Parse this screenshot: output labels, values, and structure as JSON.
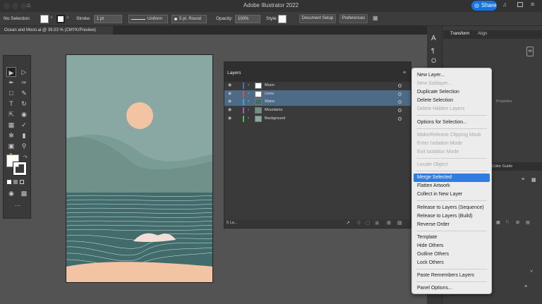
{
  "window": {
    "title": "Adobe Illustrator 2022",
    "share_label": "Share"
  },
  "controlbar": {
    "selection": "No Selection",
    "stroke_label": "Stroke:",
    "stroke_value": "1 pt",
    "uniform": "Uniform",
    "brush": "5 pt. Round",
    "opacity_label": "Opacity:",
    "opacity_value": "100%",
    "style_label": "Style:",
    "document_setup": "Document Setup",
    "preferences": "Preferences"
  },
  "document": {
    "tab": "Ocean and Moon.ai @ 39.53 % (CMYK/Preview)"
  },
  "layers_panel": {
    "title": "Layers",
    "status": "5 La...",
    "layers": [
      {
        "name": "Moon",
        "color": "#4f6bd1",
        "selected": false
      },
      {
        "name": "Lines",
        "color": "#d94f4f",
        "selected": true
      },
      {
        "name": "Water",
        "color": "#3ca3d9",
        "selected": true
      },
      {
        "name": "Mountains",
        "color": "#b04fd1",
        "selected": false
      },
      {
        "name": "Background",
        "color": "#3cc64f",
        "selected": false
      }
    ]
  },
  "right_panel": {
    "tab1": "Transform",
    "tab2": "Align",
    "properties_fragment": "Properties",
    "color_guide_fragment": "Color Guide"
  },
  "context_menu": {
    "items": [
      {
        "label": "New Layer...",
        "state": "enabled"
      },
      {
        "label": "New Sublayer...",
        "state": "disabled"
      },
      {
        "label": "Duplicate Selection",
        "state": "enabled"
      },
      {
        "label": "Delete Selection",
        "state": "enabled"
      },
      {
        "label": "Delete Hidden Layers",
        "state": "disabled"
      },
      {
        "label": "Options for Selection...",
        "state": "enabled"
      },
      {
        "label": "Make/Release Clipping Mask",
        "state": "disabled"
      },
      {
        "label": "Enter Isolation Mode",
        "state": "disabled"
      },
      {
        "label": "Exit Isolation Mode",
        "state": "disabled"
      },
      {
        "label": "Locate Object",
        "state": "disabled"
      },
      {
        "label": "Merge Selected",
        "state": "highlighted"
      },
      {
        "label": "Flatten Artwork",
        "state": "enabled"
      },
      {
        "label": "Collect in New Layer",
        "state": "enabled"
      },
      {
        "label": "Release to Layers (Sequence)",
        "state": "enabled"
      },
      {
        "label": "Release to Layers (Build)",
        "state": "enabled"
      },
      {
        "label": "Reverse Order",
        "state": "enabled"
      },
      {
        "label": "Template",
        "state": "enabled"
      },
      {
        "label": "Hide Others",
        "state": "enabled"
      },
      {
        "label": "Outline Others",
        "state": "enabled"
      },
      {
        "label": "Lock Others",
        "state": "enabled"
      },
      {
        "label": "Paste Remembers Layers",
        "state": "enabled"
      },
      {
        "label": "Panel Options...",
        "state": "enabled"
      }
    ]
  },
  "colors": {
    "accent": "#2f7de1",
    "sky": "#8aa8a3",
    "moon": "#f2c4a3",
    "mountain_far": "#6f918a",
    "mountain_near": "#5e817b",
    "water": "#426b6c",
    "sand": "#f2c4a3"
  }
}
